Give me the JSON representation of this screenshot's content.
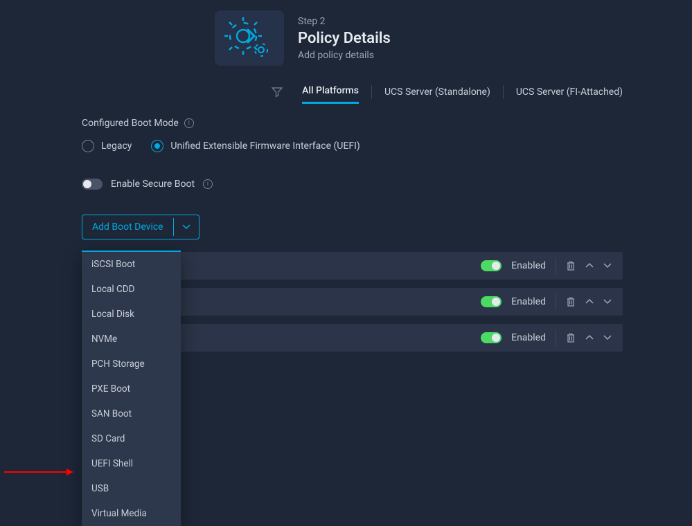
{
  "header": {
    "step_label": "Step 2",
    "title": "Policy Details",
    "description": "Add policy details"
  },
  "tabs": {
    "all": "All Platforms",
    "standalone": "UCS Server (Standalone)",
    "fi": "UCS Server (FI-Attached)"
  },
  "boot_mode": {
    "label": "Configured Boot Mode",
    "options": {
      "legacy": "Legacy",
      "uefi": "Unified Extensible Firmware Interface (UEFI)"
    }
  },
  "secure_boot_label": "Enable Secure Boot",
  "add_boot_label": "Add Boot Device",
  "enabled_label": "Enabled",
  "dropdown_items": [
    "iSCSI Boot",
    "Local CDD",
    "Local Disk",
    "NVMe",
    "PCH Storage",
    "PXE Boot",
    "SAN Boot",
    "SD Card",
    "UEFI Shell",
    "USB",
    "Virtual Media"
  ]
}
